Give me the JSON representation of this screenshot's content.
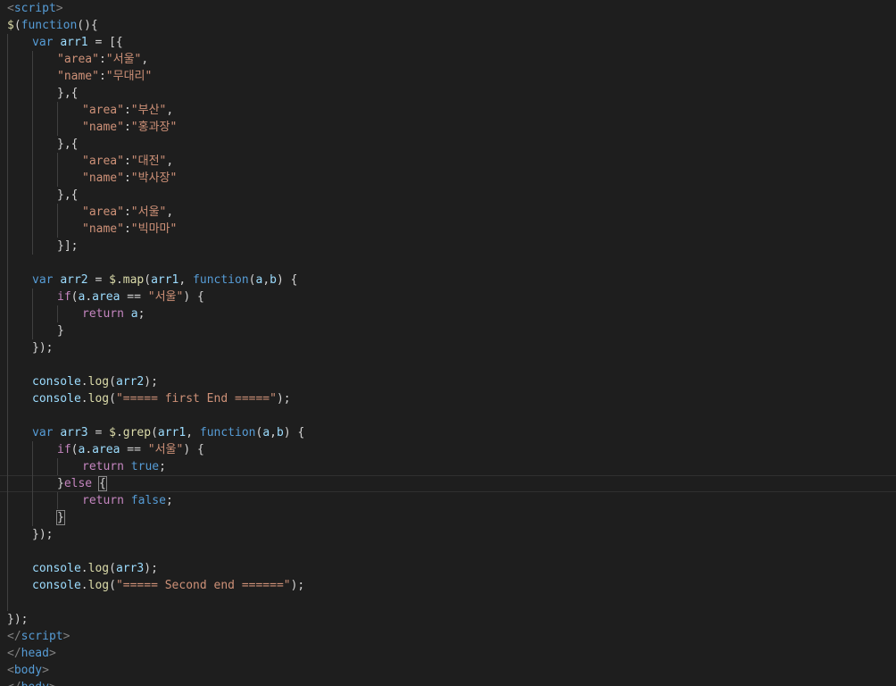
{
  "lines": [
    {
      "indent": 0,
      "guides": [],
      "tokens": [
        [
          "tag",
          "<"
        ],
        [
          "tagn",
          "script"
        ],
        [
          "tag",
          ">"
        ]
      ]
    },
    {
      "indent": 0,
      "guides": [],
      "tokens": [
        [
          "fn",
          "$"
        ],
        [
          "pun",
          "("
        ],
        [
          "kw",
          "function"
        ],
        [
          "pun",
          "(){"
        ]
      ]
    },
    {
      "indent": 1,
      "guides": [
        0
      ],
      "tokens": [
        [
          "kw",
          "var"
        ],
        [
          "pun",
          " "
        ],
        [
          "var",
          "arr1"
        ],
        [
          "pun",
          " = [{"
        ]
      ]
    },
    {
      "indent": 2,
      "guides": [
        0,
        1
      ],
      "tokens": [
        [
          "str",
          "\"area\""
        ],
        [
          "pun",
          ":"
        ],
        [
          "str",
          "\"서울\""
        ],
        [
          "pun",
          ","
        ]
      ]
    },
    {
      "indent": 2,
      "guides": [
        0,
        1
      ],
      "tokens": [
        [
          "str",
          "\"name\""
        ],
        [
          "pun",
          ":"
        ],
        [
          "str",
          "\"무대리\""
        ]
      ]
    },
    {
      "indent": 2,
      "guides": [
        0,
        1
      ],
      "tokens": [
        [
          "pun",
          "},{"
        ]
      ]
    },
    {
      "indent": 3,
      "guides": [
        0,
        1,
        2
      ],
      "tokens": [
        [
          "str",
          "\"area\""
        ],
        [
          "pun",
          ":"
        ],
        [
          "str",
          "\"부산\""
        ],
        [
          "pun",
          ","
        ]
      ]
    },
    {
      "indent": 3,
      "guides": [
        0,
        1,
        2
      ],
      "tokens": [
        [
          "str",
          "\"name\""
        ],
        [
          "pun",
          ":"
        ],
        [
          "str",
          "\"홍과장\""
        ]
      ]
    },
    {
      "indent": 2,
      "guides": [
        0,
        1
      ],
      "tokens": [
        [
          "pun",
          "},{"
        ]
      ]
    },
    {
      "indent": 3,
      "guides": [
        0,
        1,
        2
      ],
      "tokens": [
        [
          "str",
          "\"area\""
        ],
        [
          "pun",
          ":"
        ],
        [
          "str",
          "\"대전\""
        ],
        [
          "pun",
          ","
        ]
      ]
    },
    {
      "indent": 3,
      "guides": [
        0,
        1,
        2
      ],
      "tokens": [
        [
          "str",
          "\"name\""
        ],
        [
          "pun",
          ":"
        ],
        [
          "str",
          "\"박사장\""
        ]
      ]
    },
    {
      "indent": 2,
      "guides": [
        0,
        1
      ],
      "tokens": [
        [
          "pun",
          "},{"
        ]
      ]
    },
    {
      "indent": 3,
      "guides": [
        0,
        1,
        2
      ],
      "tokens": [
        [
          "str",
          "\"area\""
        ],
        [
          "pun",
          ":"
        ],
        [
          "str",
          "\"서울\""
        ],
        [
          "pun",
          ","
        ]
      ]
    },
    {
      "indent": 3,
      "guides": [
        0,
        1,
        2
      ],
      "tokens": [
        [
          "str",
          "\"name\""
        ],
        [
          "pun",
          ":"
        ],
        [
          "str",
          "\"빅마마\""
        ]
      ]
    },
    {
      "indent": 2,
      "guides": [
        0,
        1
      ],
      "tokens": [
        [
          "pun",
          "}];"
        ]
      ]
    },
    {
      "indent": 0,
      "guides": [
        0
      ],
      "tokens": []
    },
    {
      "indent": 1,
      "guides": [
        0
      ],
      "tokens": [
        [
          "kw",
          "var"
        ],
        [
          "pun",
          " "
        ],
        [
          "var",
          "arr2"
        ],
        [
          "pun",
          " = "
        ],
        [
          "fn",
          "$"
        ],
        [
          "pun",
          "."
        ],
        [
          "fn",
          "map"
        ],
        [
          "pun",
          "("
        ],
        [
          "var",
          "arr1"
        ],
        [
          "pun",
          ", "
        ],
        [
          "kw",
          "function"
        ],
        [
          "pun",
          "("
        ],
        [
          "var",
          "a"
        ],
        [
          "pun",
          ","
        ],
        [
          "var",
          "b"
        ],
        [
          "pun",
          ") {"
        ]
      ]
    },
    {
      "indent": 2,
      "guides": [
        0,
        1
      ],
      "tokens": [
        [
          "ctl",
          "if"
        ],
        [
          "pun",
          "("
        ],
        [
          "var",
          "a"
        ],
        [
          "pun",
          "."
        ],
        [
          "var",
          "area"
        ],
        [
          "pun",
          " == "
        ],
        [
          "str",
          "\"서울\""
        ],
        [
          "pun",
          ") {"
        ]
      ]
    },
    {
      "indent": 3,
      "guides": [
        0,
        1,
        2
      ],
      "tokens": [
        [
          "ctl",
          "return"
        ],
        [
          "pun",
          " "
        ],
        [
          "var",
          "a"
        ],
        [
          "pun",
          ";"
        ]
      ]
    },
    {
      "indent": 2,
      "guides": [
        0,
        1
      ],
      "tokens": [
        [
          "pun",
          "}"
        ]
      ]
    },
    {
      "indent": 1,
      "guides": [
        0
      ],
      "tokens": [
        [
          "pun",
          "});"
        ]
      ]
    },
    {
      "indent": 0,
      "guides": [
        0
      ],
      "tokens": []
    },
    {
      "indent": 1,
      "guides": [
        0
      ],
      "tokens": [
        [
          "var",
          "console"
        ],
        [
          "pun",
          "."
        ],
        [
          "fn",
          "log"
        ],
        [
          "pun",
          "("
        ],
        [
          "var",
          "arr2"
        ],
        [
          "pun",
          ");"
        ]
      ]
    },
    {
      "indent": 1,
      "guides": [
        0
      ],
      "tokens": [
        [
          "var",
          "console"
        ],
        [
          "pun",
          "."
        ],
        [
          "fn",
          "log"
        ],
        [
          "pun",
          "("
        ],
        [
          "str",
          "\"===== first End =====\""
        ],
        [
          "pun",
          ");"
        ]
      ]
    },
    {
      "indent": 0,
      "guides": [
        0
      ],
      "tokens": []
    },
    {
      "indent": 1,
      "guides": [
        0
      ],
      "tokens": [
        [
          "kw",
          "var"
        ],
        [
          "pun",
          " "
        ],
        [
          "var",
          "arr3"
        ],
        [
          "pun",
          " = "
        ],
        [
          "fn",
          "$"
        ],
        [
          "pun",
          "."
        ],
        [
          "fn",
          "grep"
        ],
        [
          "pun",
          "("
        ],
        [
          "var",
          "arr1"
        ],
        [
          "pun",
          ", "
        ],
        [
          "kw",
          "function"
        ],
        [
          "pun",
          "("
        ],
        [
          "var",
          "a"
        ],
        [
          "pun",
          ","
        ],
        [
          "var",
          "b"
        ],
        [
          "pun",
          ") {"
        ]
      ]
    },
    {
      "indent": 2,
      "guides": [
        0,
        1
      ],
      "tokens": [
        [
          "ctl",
          "if"
        ],
        [
          "pun",
          "("
        ],
        [
          "var",
          "a"
        ],
        [
          "pun",
          "."
        ],
        [
          "var",
          "area"
        ],
        [
          "pun",
          " == "
        ],
        [
          "str",
          "\"서울\""
        ],
        [
          "pun",
          ") {"
        ]
      ]
    },
    {
      "indent": 3,
      "guides": [
        0,
        1,
        2
      ],
      "tokens": [
        [
          "ctl",
          "return"
        ],
        [
          "pun",
          " "
        ],
        [
          "bool",
          "true"
        ],
        [
          "pun",
          ";"
        ]
      ]
    },
    {
      "indent": 2,
      "guides": [
        0,
        1
      ],
      "current": true,
      "tokens": [
        [
          "pun",
          "}"
        ],
        [
          "ctl",
          "else"
        ],
        [
          "pun",
          " "
        ],
        [
          "brk",
          "{"
        ]
      ]
    },
    {
      "indent": 3,
      "guides": [
        0,
        1,
        2
      ],
      "tokens": [
        [
          "ctl",
          "return"
        ],
        [
          "pun",
          " "
        ],
        [
          "bool",
          "false"
        ],
        [
          "pun",
          ";"
        ]
      ]
    },
    {
      "indent": 2,
      "guides": [
        0,
        1
      ],
      "tokens": [
        [
          "brk",
          "}"
        ]
      ]
    },
    {
      "indent": 1,
      "guides": [
        0
      ],
      "tokens": [
        [
          "pun",
          "});"
        ]
      ]
    },
    {
      "indent": 0,
      "guides": [
        0
      ],
      "tokens": []
    },
    {
      "indent": 1,
      "guides": [
        0
      ],
      "tokens": [
        [
          "var",
          "console"
        ],
        [
          "pun",
          "."
        ],
        [
          "fn",
          "log"
        ],
        [
          "pun",
          "("
        ],
        [
          "var",
          "arr3"
        ],
        [
          "pun",
          ");"
        ]
      ]
    },
    {
      "indent": 1,
      "guides": [
        0
      ],
      "tokens": [
        [
          "var",
          "console"
        ],
        [
          "pun",
          "."
        ],
        [
          "fn",
          "log"
        ],
        [
          "pun",
          "("
        ],
        [
          "str",
          "\"===== Second end ======\""
        ],
        [
          "pun",
          ");"
        ]
      ]
    },
    {
      "indent": 0,
      "guides": [
        0
      ],
      "tokens": []
    },
    {
      "indent": 0,
      "guides": [],
      "tokens": [
        [
          "pun",
          "});"
        ]
      ]
    },
    {
      "indent": 0,
      "guides": [],
      "tokens": [
        [
          "tag",
          "</"
        ],
        [
          "tagn",
          "script"
        ],
        [
          "tag",
          ">"
        ]
      ]
    },
    {
      "indent": 0,
      "guides": [],
      "tokens": [
        [
          "tag",
          "</"
        ],
        [
          "tagn",
          "head"
        ],
        [
          "tag",
          ">"
        ]
      ]
    },
    {
      "indent": 0,
      "guides": [],
      "tokens": [
        [
          "tag",
          "<"
        ],
        [
          "tagn",
          "body"
        ],
        [
          "tag",
          ">"
        ]
      ]
    },
    {
      "indent": 0,
      "guides": [],
      "tokens": [
        [
          "tag",
          "</"
        ],
        [
          "tagn",
          "body"
        ],
        [
          "tag",
          ">"
        ]
      ]
    }
  ]
}
